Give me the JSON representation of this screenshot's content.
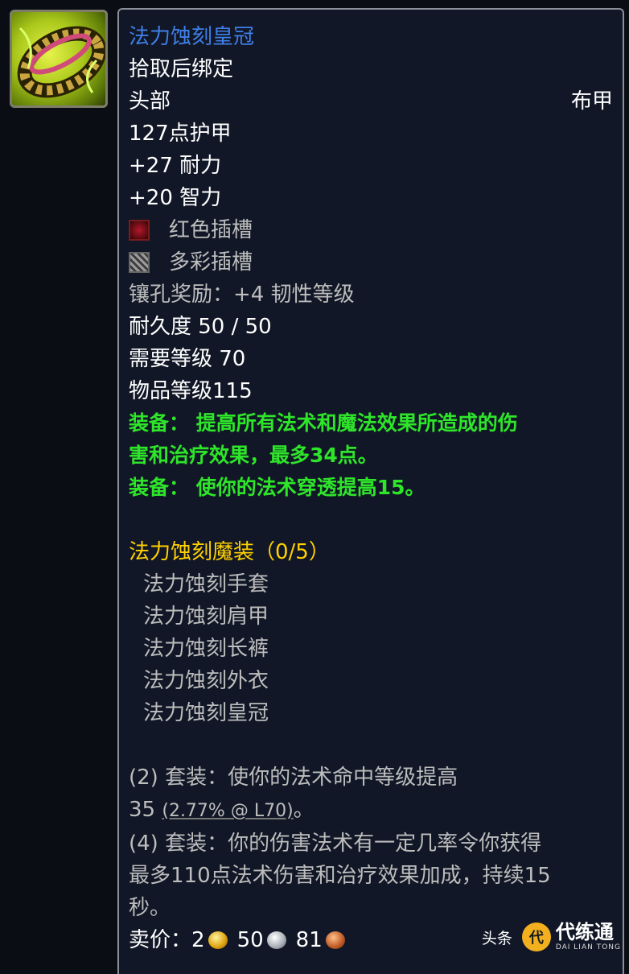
{
  "item": {
    "name": "法力蚀刻皇冠",
    "binding": "拾取后绑定",
    "slot": "头部",
    "armor_type": "布甲",
    "armor": "127点护甲",
    "stats": [
      "+27 耐力",
      "+20 智力"
    ],
    "sockets": [
      {
        "label": "红色插槽",
        "icon": "red-socket-icon"
      },
      {
        "label": "多彩插槽",
        "icon": "prismatic-socket-icon"
      }
    ],
    "socket_bonus": "镶孔奖励：+4 韧性等级",
    "durability": "耐久度 50 / 50",
    "required_level": "需要等级 70",
    "item_level": "物品等级115",
    "equip_effects": [
      "装备： 提高所有法术和魔法效果所造成的伤",
      "害和治疗效果，最多34点。",
      "装备： 使你的法术穿透提高15。"
    ]
  },
  "set": {
    "name": "法力蚀刻魔装（0/5）",
    "pieces": [
      "法力蚀刻手套",
      "法力蚀刻肩甲",
      "法力蚀刻长裤",
      "法力蚀刻外衣",
      "法力蚀刻皇冠"
    ],
    "bonus2_line1": "(2) 套装：使你的法术命中等级提高",
    "bonus2_value": "35",
    "bonus2_note": "(2.77% @ L70)",
    "bonus2_end": "。",
    "bonus4_lines": [
      "(4) 套装：你的伤害法术有一定几率令你获得",
      "最多110点法术伤害和治疗效果加成，持续15",
      "秒。"
    ]
  },
  "sell": {
    "label": "卖价：",
    "gold": "2",
    "silver": "50",
    "copper": "81"
  },
  "watermark": {
    "source": "头条",
    "brand": "代练通",
    "sub": "DAI LIAN TONG",
    "logo_char": "代"
  },
  "colors": {
    "title": "#3f7fe8",
    "effect_green": "#2ee52a",
    "set_gold": "#ffd100",
    "inactive_gray": "#bdbdbd",
    "tooltip_bg": "#111726"
  },
  "icons": [
    "circlet-item-icon",
    "red-socket-icon",
    "prismatic-socket-icon",
    "gold-coin-icon",
    "silver-coin-icon",
    "copper-coin-icon"
  ]
}
